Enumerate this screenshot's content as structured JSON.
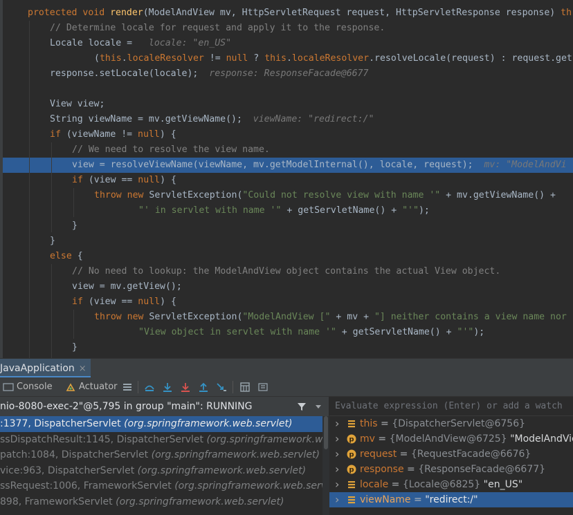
{
  "editor": {
    "lines": [
      {
        "indent": 1,
        "segments": [
          {
            "t": "protected void ",
            "c": "kw"
          },
          {
            "t": "render",
            "c": "fn"
          },
          {
            "t": "(ModelAndView mv, HttpServletRequest request, HttpServletResponse response) ",
            "c": ""
          },
          {
            "t": "th",
            "c": "kw"
          }
        ]
      },
      {
        "indent": 2,
        "segments": [
          {
            "t": "// Determine locale for request and apply it to the response.",
            "c": "cm"
          }
        ]
      },
      {
        "indent": 2,
        "segments": [
          {
            "t": "Locale locale = ",
            "c": ""
          },
          {
            "t": "  locale: \"en_US\"",
            "c": "hint"
          }
        ]
      },
      {
        "indent": 4,
        "segments": [
          {
            "t": "(",
            "c": ""
          },
          {
            "t": "this",
            "c": "kw"
          },
          {
            "t": ".",
            "c": ""
          },
          {
            "t": "localeResolver",
            "c": "kw"
          },
          {
            "t": " != ",
            "c": ""
          },
          {
            "t": "null",
            "c": "kw"
          },
          {
            "t": " ? ",
            "c": ""
          },
          {
            "t": "this",
            "c": "kw"
          },
          {
            "t": ".",
            "c": ""
          },
          {
            "t": "localeResolver",
            "c": "kw"
          },
          {
            "t": ".resolveLocale(request) : request.get",
            "c": ""
          }
        ]
      },
      {
        "indent": 2,
        "segments": [
          {
            "t": "response.setLocale(locale);",
            "c": ""
          },
          {
            "t": "  response: ResponseFacade@6677",
            "c": "hint"
          }
        ]
      },
      {
        "indent": 0,
        "segments": []
      },
      {
        "indent": 2,
        "segments": [
          {
            "t": "View view;",
            "c": ""
          }
        ]
      },
      {
        "indent": 2,
        "segments": [
          {
            "t": "String viewName = mv.getViewName();",
            "c": ""
          },
          {
            "t": "  viewName: \"redirect:/\"",
            "c": "hint"
          }
        ]
      },
      {
        "indent": 2,
        "segments": [
          {
            "t": "if",
            "c": "kw"
          },
          {
            "t": " (viewName != ",
            "c": ""
          },
          {
            "t": "null",
            "c": "kw"
          },
          {
            "t": ") {",
            "c": ""
          }
        ]
      },
      {
        "indent": 3,
        "segments": [
          {
            "t": "// We need to resolve the view name.",
            "c": "cm"
          }
        ]
      },
      {
        "indent": 3,
        "highlight": true,
        "segments": [
          {
            "t": "view = resolveViewName(viewName, mv.getModelInternal(), locale, request);",
            "c": ""
          },
          {
            "t": "  mv: \"ModelAndVi",
            "c": "hint"
          }
        ]
      },
      {
        "indent": 3,
        "segments": [
          {
            "t": "if",
            "c": "kw"
          },
          {
            "t": " (view == ",
            "c": ""
          },
          {
            "t": "null",
            "c": "kw"
          },
          {
            "t": ") {",
            "c": ""
          }
        ]
      },
      {
        "indent": 4,
        "segments": [
          {
            "t": "throw new ",
            "c": "kw"
          },
          {
            "t": "ServletException(",
            "c": ""
          },
          {
            "t": "\"Could not resolve view with name '\"",
            "c": "st"
          },
          {
            "t": " + mv.getViewName() +",
            "c": ""
          }
        ]
      },
      {
        "indent": 6,
        "segments": [
          {
            "t": "\"' in servlet with name '\"",
            "c": "st"
          },
          {
            "t": " + getServletName() + ",
            "c": ""
          },
          {
            "t": "\"'\"",
            "c": "st"
          },
          {
            "t": ");",
            "c": ""
          }
        ]
      },
      {
        "indent": 3,
        "segments": [
          {
            "t": "}",
            "c": ""
          }
        ]
      },
      {
        "indent": 2,
        "segments": [
          {
            "t": "}",
            "c": ""
          }
        ]
      },
      {
        "indent": 2,
        "segments": [
          {
            "t": "else",
            "c": "kw"
          },
          {
            "t": " {",
            "c": ""
          }
        ]
      },
      {
        "indent": 3,
        "segments": [
          {
            "t": "// No need to lookup: the ModelAndView object contains the actual View object.",
            "c": "cm"
          }
        ]
      },
      {
        "indent": 3,
        "segments": [
          {
            "t": "view = mv.getView();",
            "c": ""
          }
        ]
      },
      {
        "indent": 3,
        "segments": [
          {
            "t": "if",
            "c": "kw"
          },
          {
            "t": " (view == ",
            "c": ""
          },
          {
            "t": "null",
            "c": "kw"
          },
          {
            "t": ") {",
            "c": ""
          }
        ]
      },
      {
        "indent": 4,
        "segments": [
          {
            "t": "throw new ",
            "c": "kw"
          },
          {
            "t": "ServletException(",
            "c": ""
          },
          {
            "t": "\"ModelAndView [\"",
            "c": "st"
          },
          {
            "t": " + mv + ",
            "c": ""
          },
          {
            "t": "\"] neither contains a view name nor",
            "c": "st"
          }
        ]
      },
      {
        "indent": 6,
        "segments": [
          {
            "t": "\"View object in servlet with name '\"",
            "c": "st"
          },
          {
            "t": " + getServletName() + ",
            "c": ""
          },
          {
            "t": "\"'\"",
            "c": "st"
          },
          {
            "t": ");",
            "c": ""
          }
        ]
      },
      {
        "indent": 3,
        "segments": [
          {
            "t": "}",
            "c": ""
          }
        ]
      }
    ]
  },
  "debug": {
    "tab_label": "JavaApplication",
    "tab_close": "×",
    "toolbar": {
      "console_label": "Console",
      "actuator_label": "Actuator"
    },
    "thread_label": "nio-8080-exec-2\"@5,795 in group \"main\": RUNNING",
    "evaluate_placeholder": "Evaluate expression (Enter) or add a watch",
    "frames": [
      {
        "main": ":1377, DispatcherServlet ",
        "pkg": "(org.springframework.web.servlet)",
        "selected": true
      },
      {
        "main": "ssDispatchResult:1145, DispatcherServlet ",
        "pkg": "(org.springframework.we",
        "selected": false
      },
      {
        "main": "patch:1084, DispatcherServlet ",
        "pkg": "(org.springframework.web.servlet)",
        "selected": false
      },
      {
        "main": "vice:963, DispatcherServlet ",
        "pkg": "(org.springframework.web.servlet)",
        "selected": false
      },
      {
        "main": "ssRequest:1006, FrameworkServlet ",
        "pkg": "(org.springframework.web.serv",
        "selected": false
      },
      {
        "main": "898, FrameworkServlet ",
        "pkg": "(org.springframework.web.servlet)",
        "selected": false
      }
    ],
    "variables": [
      {
        "icon": "field-icon",
        "name": "this",
        "eq": " = ",
        "obj": "{DispatcherServlet@6756}",
        "str": "",
        "selected": false
      },
      {
        "icon": "parameter-icon",
        "name": "mv",
        "eq": " = ",
        "obj": "{ModelAndView@6725}",
        "str": " \"ModelAndView",
        "selected": false
      },
      {
        "icon": "parameter-icon",
        "name": "request",
        "eq": " = ",
        "obj": "{RequestFacade@6676}",
        "str": "",
        "selected": false
      },
      {
        "icon": "parameter-icon",
        "name": "response",
        "eq": " = ",
        "obj": "{ResponseFacade@6677}",
        "str": "",
        "selected": false
      },
      {
        "icon": "field-icon",
        "name": "locale",
        "eq": " = ",
        "obj": "{Locale@6825}",
        "str": " \"en_US\"",
        "selected": false
      },
      {
        "icon": "field-icon",
        "name": "viewName",
        "eq": " = ",
        "obj": "",
        "str": "\"redirect:/\"",
        "selected": true
      }
    ]
  }
}
